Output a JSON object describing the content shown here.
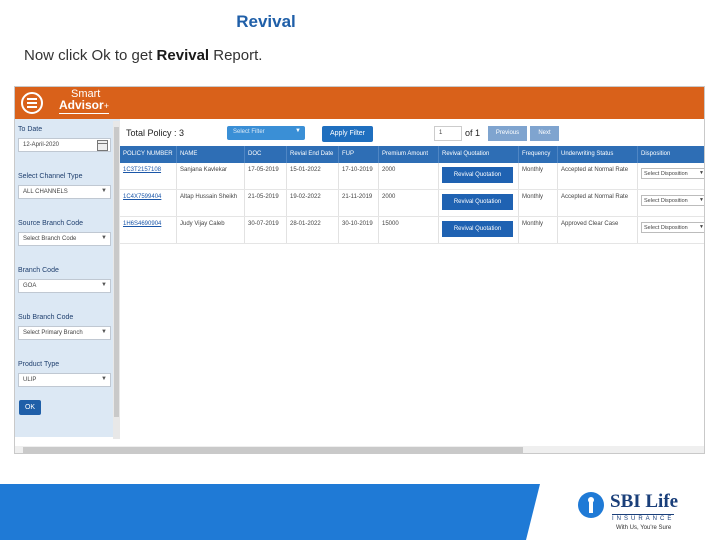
{
  "slide": {
    "title": "Revival",
    "instruction_pre": "Now click Ok to get ",
    "instruction_bold": "Revival",
    "instruction_post": " Report."
  },
  "app": {
    "brand_line1": "Smart",
    "brand_line2": "Advisor",
    "brand_plus": "+",
    "header_color": "#d9611a"
  },
  "filters": {
    "to_date_label": "To Date",
    "to_date_value": "12-April-2020",
    "channel_label": "Select Channel Type",
    "channel_value": "ALL CHANNELS",
    "source_branch_label": "Source Branch Code",
    "source_branch_value": "Select Branch Code",
    "branch_label": "Branch Code",
    "branch_value": "GOA",
    "sub_branch_label": "Sub Branch Code",
    "sub_branch_value": "Select Primary Branch",
    "product_label": "Product Type",
    "product_value": "ULIP",
    "ok_label": "OK"
  },
  "toolbar": {
    "total_label": "Total Policy : 3",
    "filter_placeholder": "Select Filter",
    "apply_label": "Apply Filter",
    "page_value": "1",
    "of_label": "of 1",
    "previous_label": "Previous",
    "next_label": "Next"
  },
  "table": {
    "headers": [
      "POLICY NUMBER",
      "NAME",
      "DOC",
      "Revial End Date",
      "FUP",
      "Premium Amount",
      "Revival Quotation",
      "Frequency",
      "Underwriting Status",
      "Disposition"
    ],
    "rows": [
      {
        "policy": "1C3T2157108",
        "name": "Sanjana Kavlekar",
        "doc": "17-05-2019",
        "end": "15-01-2022",
        "fup": "17-10-2019",
        "premium": "2000",
        "quote": "Revival Quotation",
        "freq": "Monthly",
        "uw": "Accepted at Normal Rate",
        "disp": "Select Disposition"
      },
      {
        "policy": "1C4X7599404",
        "name": "Altap Hussain Sheikh",
        "doc": "21-05-2019",
        "end": "19-02-2022",
        "fup": "21-11-2019",
        "premium": "2000",
        "quote": "Revival Quotation",
        "freq": "Monthly",
        "uw": "Accepted at Normal Rate",
        "disp": "Select Disposition"
      },
      {
        "policy": "1H6S4690904",
        "name": "Judy Vijay Caleb",
        "doc": "30-07-2019",
        "end": "28-01-2022",
        "fup": "30-10-2019",
        "premium": "15000",
        "quote": "Revival Quotation",
        "freq": "Monthly",
        "uw": "Approved Clear Case",
        "disp": "Select Disposition"
      }
    ]
  },
  "footer": {
    "logo_name": "SBI Life",
    "logo_sub": "INSURANCE",
    "logo_tagline": "With Us, You're Sure",
    "brand_blue": "#1f7ad6"
  }
}
